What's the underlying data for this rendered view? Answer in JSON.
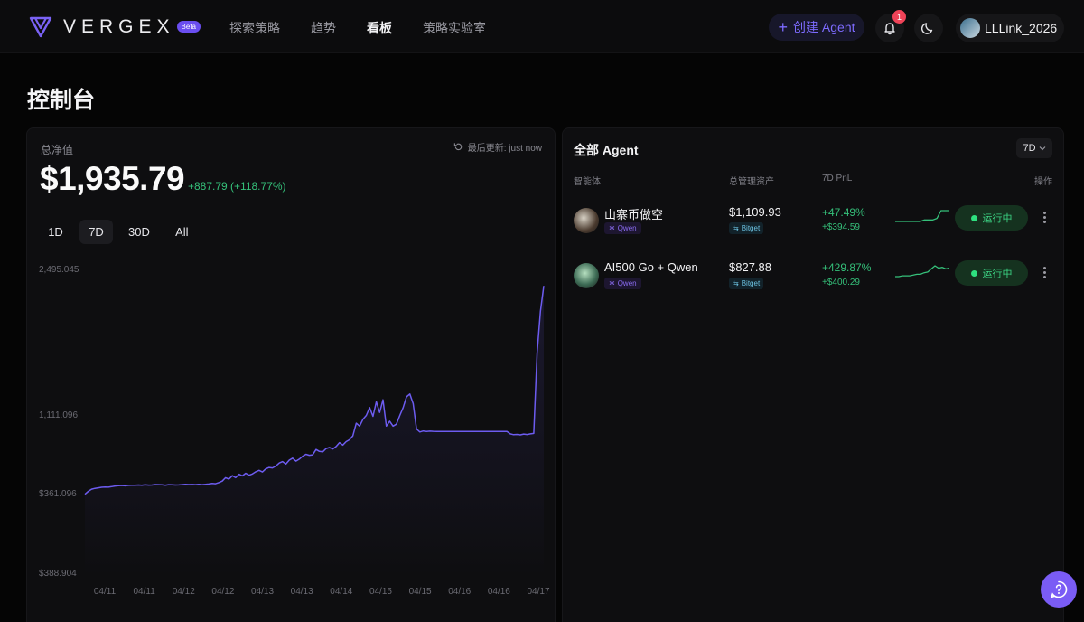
{
  "header": {
    "brand": "VERGEX",
    "beta": "Beta",
    "nav": [
      "探索策略",
      "趋势",
      "看板",
      "策略实验室"
    ],
    "active_nav": 2,
    "create_label": "创建 Agent",
    "notification_count": "1",
    "username": "LLLink_2026",
    "icons": [
      "vergex-logo-icon",
      "plus-icon",
      "bell-icon",
      "moon-icon",
      "user-avatar",
      "help-chat-icon",
      "refresh-icon"
    ]
  },
  "page": {
    "title": "控制台"
  },
  "overview": {
    "label": "总净值",
    "updated": "最后更新: just now",
    "value": "$1,935.79",
    "change": "+887.79 (+118.77%)",
    "ranges": [
      "1D",
      "7D",
      "30D",
      "All"
    ],
    "active_range": "7D"
  },
  "chart_data": {
    "type": "area",
    "color": "#6d5cf0",
    "y_tick_labels": [
      "2,495.045",
      "1,111.096",
      "$361.096",
      "$388.904"
    ],
    "x_tick_labels": [
      "04/11",
      "04/11",
      "04/12",
      "04/12",
      "04/13",
      "04/13",
      "04/14",
      "04/15",
      "04/15",
      "04/16",
      "04/16",
      "04/17"
    ],
    "values": [
      300,
      330,
      352,
      360,
      366,
      371,
      374,
      372,
      378,
      384,
      388,
      390,
      386,
      391,
      393,
      392,
      395,
      393,
      397,
      394,
      395,
      399,
      398,
      397,
      393,
      398,
      397,
      395,
      396,
      398,
      401,
      399,
      400,
      398,
      402,
      398,
      401,
      405,
      410,
      408,
      420,
      435,
      470,
      455,
      490,
      470,
      505,
      488,
      515,
      495,
      508,
      530,
      545,
      528,
      560,
      575,
      570,
      590,
      620,
      635,
      610,
      650,
      670,
      640,
      660,
      690,
      710,
      700,
      705,
      760,
      740,
      735,
      770,
      780,
      765,
      790,
      830,
      805,
      840,
      860,
      900,
      1030,
      1000,
      1070,
      1110,
      1190,
      1100,
      1250,
      1140,
      1270,
      1000,
      1050,
      1000,
      1020,
      1110,
      1190,
      1300,
      1330,
      1230,
      970,
      940,
      950,
      945,
      948,
      946,
      945,
      944,
      945,
      944,
      945,
      944,
      945,
      944,
      945,
      944,
      945,
      944,
      945,
      944,
      945,
      944,
      945,
      944,
      945,
      944,
      945,
      944,
      920,
      912,
      915,
      910,
      918,
      914,
      920,
      925,
      1750,
      2180,
      2440
    ]
  },
  "agents": {
    "title": "全部 Agent",
    "period": "7D",
    "columns": [
      "智能体",
      "总管理资产",
      "7D PnL",
      "操作"
    ],
    "rows": [
      {
        "name": "山寨币做空",
        "model": "Qwen",
        "aum": "$1,109.93",
        "exchange": "Bitget",
        "pnl_pct": "+47.49%",
        "pnl_abs": "+$394.59",
        "status": "运行中",
        "spark": [
          2,
          2,
          2,
          2,
          2,
          2,
          2,
          3,
          3,
          3,
          4,
          9,
          9,
          9
        ]
      },
      {
        "name": "AI500 Go + Qwen",
        "model": "Qwen",
        "aum": "$827.88",
        "exchange": "Bitget",
        "pnl_pct": "+429.87%",
        "pnl_abs": "+$400.29",
        "status": "运行中",
        "spark": [
          1,
          1,
          2,
          2,
          2,
          3,
          4,
          4,
          6,
          7,
          11,
          15,
          12,
          13,
          11,
          12
        ]
      }
    ]
  }
}
